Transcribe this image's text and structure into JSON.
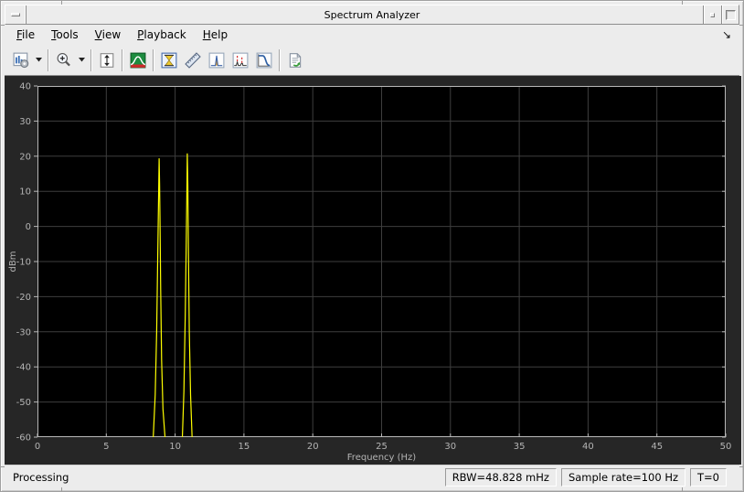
{
  "window": {
    "title": "Spectrum Analyzer",
    "titlebar_icons": [
      "window-menu-icon",
      "minimize-icon",
      "maximize-icon"
    ]
  },
  "menubar": {
    "items": [
      {
        "label": "File",
        "accel": "F"
      },
      {
        "label": "Tools",
        "accel": "T"
      },
      {
        "label": "View",
        "accel": "V"
      },
      {
        "label": "Playback",
        "accel": "P"
      },
      {
        "label": "Help",
        "accel": "H"
      }
    ],
    "dock_arrow_icon": "dock-arrow-icon",
    "dock_arrow_glyph": "↘"
  },
  "toolbar": {
    "icons": [
      "display-options-icon",
      "zoom-in-icon",
      "scale-y-axis-icon",
      "spectrum-settings-icon",
      "cursor-measurements-icon",
      "signal-statistics-icon",
      "peak-finder-icon",
      "distortion-measurements-icon",
      "ccdf-measurements-icon",
      "generate-script-icon"
    ]
  },
  "statusbar": {
    "left": "Processing",
    "segments": [
      "RBW=48.828 mHz",
      "Sample rate=100 Hz",
      "T=0"
    ]
  },
  "chart_data": {
    "type": "line",
    "title": "",
    "xlabel": "Frequency (Hz)",
    "ylabel": "dBm",
    "xlim": [
      0,
      50
    ],
    "ylim": [
      -60,
      40
    ],
    "xticks": [
      0,
      5,
      10,
      15,
      20,
      25,
      30,
      35,
      40,
      45,
      50
    ],
    "yticks": [
      40,
      30,
      20,
      10,
      0,
      -10,
      -20,
      -30,
      -40,
      -50,
      -60
    ],
    "grid": true,
    "legend": "none",
    "background": "#000000",
    "grid_color": "#3e3e3e",
    "axis_color": "#b8b8b8",
    "label_color": "#b4b4b4",
    "series": [
      {
        "name": "spectrum-trace",
        "color": "#ffff00",
        "points": [
          [
            0,
            -61
          ],
          [
            8.4,
            -61
          ],
          [
            8.55,
            -48
          ],
          [
            8.66,
            -30
          ],
          [
            8.74,
            -8
          ],
          [
            8.8,
            8
          ],
          [
            8.84,
            19.4
          ],
          [
            8.87,
            12
          ],
          [
            8.9,
            3
          ],
          [
            8.95,
            -18
          ],
          [
            9.02,
            -38
          ],
          [
            9.12,
            -52
          ],
          [
            9.28,
            -61
          ],
          [
            10.52,
            -61
          ],
          [
            10.64,
            -47
          ],
          [
            10.74,
            -25
          ],
          [
            10.82,
            -2
          ],
          [
            10.86,
            13
          ],
          [
            10.88,
            20.8
          ],
          [
            10.92,
            12
          ],
          [
            10.96,
            -6
          ],
          [
            11.03,
            -30
          ],
          [
            11.12,
            -48
          ],
          [
            11.24,
            -61
          ],
          [
            50,
            -61
          ]
        ]
      }
    ]
  }
}
